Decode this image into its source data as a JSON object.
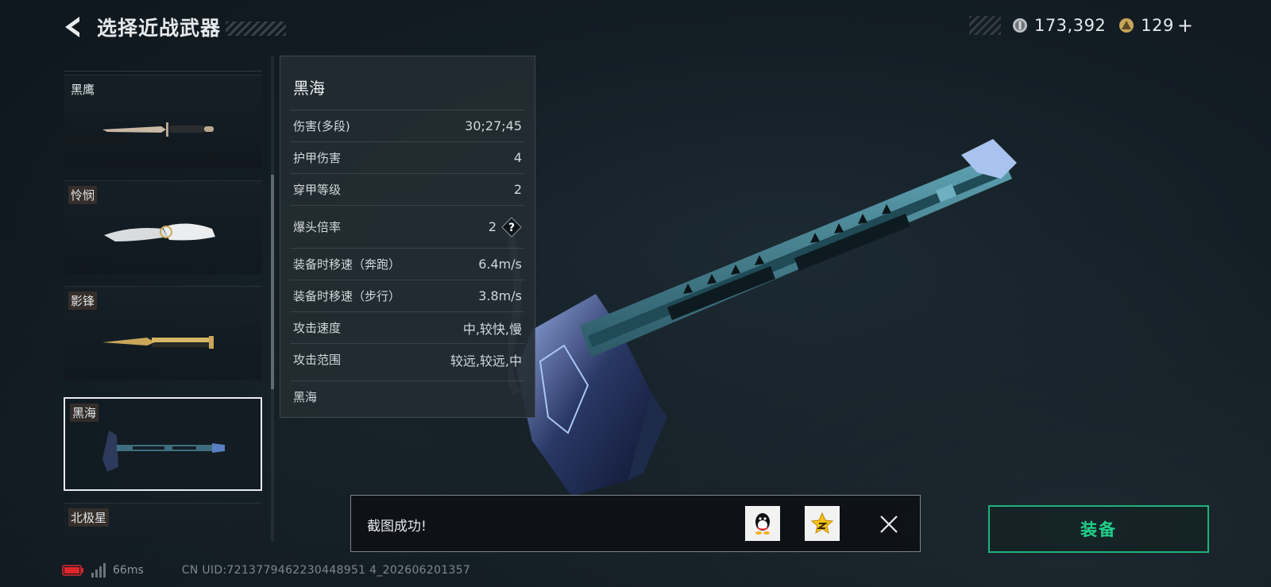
{
  "header": {
    "title": "选择近战武器"
  },
  "currency": {
    "silver": "173,392",
    "gold": "129",
    "plus": "+"
  },
  "weapons": [
    {
      "name": "黑鹰",
      "tagged": false
    },
    {
      "name": "怜悯",
      "tagged": true
    },
    {
      "name": "影锋",
      "tagged": true
    },
    {
      "name": "黑海",
      "tagged": true,
      "selected": true
    },
    {
      "name": "北极星",
      "tagged": true
    }
  ],
  "stats": {
    "title": "黑海",
    "rows": [
      {
        "label": "伤害(多段)",
        "value": "30;27;45"
      },
      {
        "label": "护甲伤害",
        "value": "4"
      },
      {
        "label": "穿甲等级",
        "value": "2"
      },
      {
        "label": "爆头倍率",
        "value": "2"
      },
      {
        "label": "装备时移速（奔跑）",
        "value": "6.4m/s"
      },
      {
        "label": "装备时移速（步行）",
        "value": "3.8m/s"
      },
      {
        "label": "攻击速度",
        "value": "中,较快,慢"
      },
      {
        "label": "攻击范围",
        "value": "较远,较远,中"
      }
    ],
    "help_icon": "?",
    "description": "黑海"
  },
  "toast": {
    "message": "截图成功!"
  },
  "equip": {
    "label": "装备"
  },
  "status": {
    "ping": "66ms",
    "uid": "CN UID:7213779462230448951 4_202606201357"
  },
  "colors": {
    "accent_green": "#1fd08a",
    "background": "#131d24",
    "battery_red": "#e0262b"
  },
  "icons": [
    "back-arrow-icon",
    "silver-coin-icon",
    "gold-coin-icon",
    "help-icon",
    "qq-icon",
    "qzone-star-icon",
    "close-icon",
    "battery-icon",
    "signal-icon"
  ]
}
